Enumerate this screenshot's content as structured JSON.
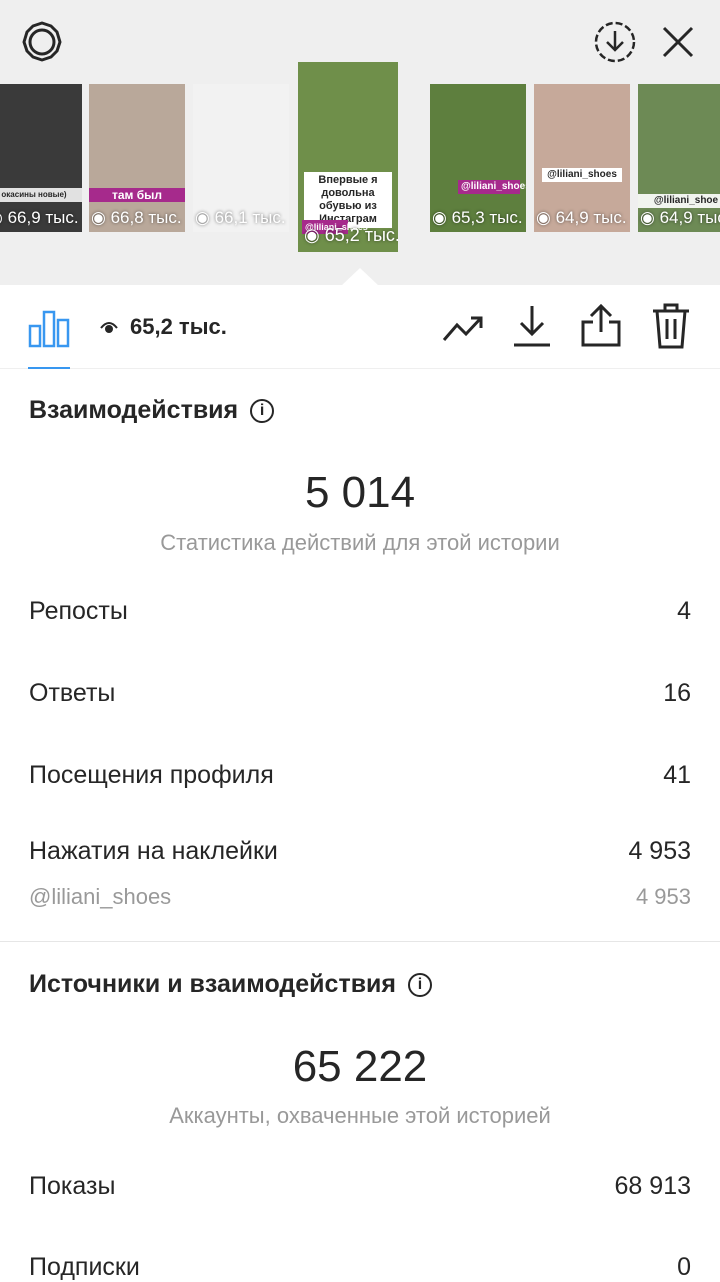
{
  "header": {
    "settings_icon": "gear-icon",
    "download_icon": "download-circle-icon",
    "close_icon": "close-icon"
  },
  "thumbnails": [
    {
      "views": "66,9 тыс.",
      "caption": "окасины новые)",
      "bg": "#3a3a3a"
    },
    {
      "views": "66,8 тыс.",
      "caption": "там был",
      "bg": "#b9a89a"
    },
    {
      "views": "66,1 тыс.",
      "caption": "",
      "bg": "#f2f2f2"
    },
    {
      "views": "65,2 тыс.",
      "caption": "Впервые я довольна обувью из Инстаграм",
      "tag": "@liliani_shoes",
      "bg": "#6f8f4a",
      "active": true
    },
    {
      "views": "65,3 тыс.",
      "caption": "@liliani_shoes",
      "bg": "#5e7f3e"
    },
    {
      "views": "64,9 тыс.",
      "caption": "@liliani_shoes",
      "bg": "#c6a99a"
    },
    {
      "views": "64,9 тыс.",
      "caption": "@liliani_shoe",
      "bg": "#6d8a55"
    }
  ],
  "toolbar": {
    "views_icon": "eye-icon",
    "views": "65,2 тыс.",
    "chart_icon": "bar-chart-icon",
    "trend_icon": "trend-up-icon",
    "save_icon": "download-icon",
    "share_icon": "share-icon",
    "delete_icon": "trash-icon",
    "accent": "#3897f0"
  },
  "interactions": {
    "title": "Взаимодействия",
    "total": "5 014",
    "caption": "Статистика действий для этой истории",
    "rows": [
      {
        "label": "Репосты",
        "value": "4"
      },
      {
        "label": "Ответы",
        "value": "16"
      },
      {
        "label": "Посещения профиля",
        "value": "41"
      },
      {
        "label": "Нажатия на наклейки",
        "value": "4 953"
      }
    ],
    "sub_row": {
      "label": "@liliani_shoes",
      "value": "4 953"
    }
  },
  "discovery": {
    "title": "Источники и взаимодействия",
    "total": "65 222",
    "caption": "Аккаунты, охваченные этой историей",
    "rows": [
      {
        "label": "Показы",
        "value": "68 913"
      },
      {
        "label": "Подписки",
        "value": "0"
      }
    ]
  }
}
